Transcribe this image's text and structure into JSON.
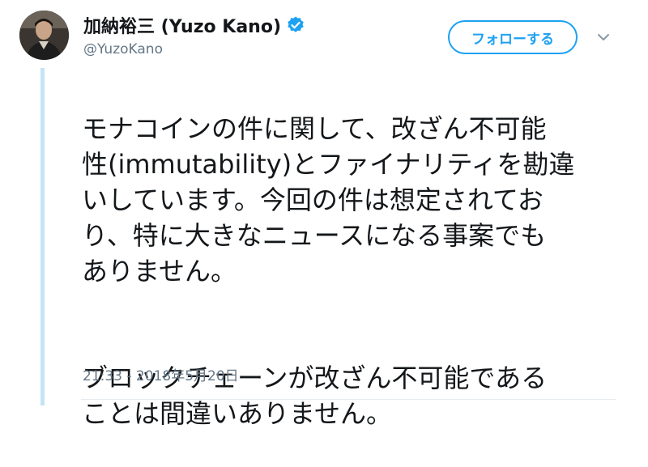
{
  "user": {
    "display_name": "加納裕三 (Yuzo Kano)",
    "handle": "@YuzoKano",
    "verified": true
  },
  "actions": {
    "follow_label": "フォローする",
    "menu_icon": "chevron-down-icon"
  },
  "tweet": {
    "paragraphs": [
      "モナコインの件に関して、改ざん不可能\n性(immutability)とファイナリティを勘違\nいしています。今回の件は想定されてお\nり、特に大きなニュースになる事案でも\nありません。",
      "ブロックチェーンが改ざん不可能である\nことは間違いありません。"
    ],
    "timestamp": "21:33 - 2018年5月20日"
  },
  "colors": {
    "accent": "#1da1f2",
    "text": "#14171a",
    "muted": "#657786",
    "thread_line": "#c4e4f5"
  }
}
